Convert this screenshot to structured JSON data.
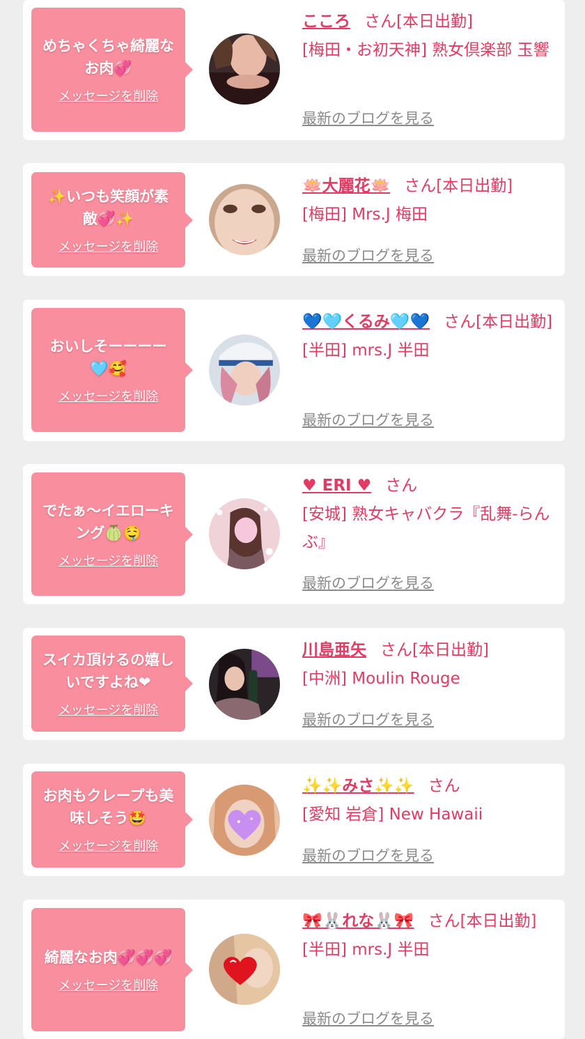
{
  "common": {
    "delete_label": "メッセージを削除",
    "blog_label": "最新のブログを見る"
  },
  "colors": {
    "bubble": "#f98f9e",
    "accent": "#e03c63",
    "link_gray": "#8a8a8a",
    "background": "#eeeeee"
  },
  "entries": [
    {
      "message": "めちゃくちゃ綺麗なお肉💞",
      "name": "こころ",
      "suffix": "さん[本日出勤]",
      "shop": "[梅田・お初天神] 熟女倶楽部 玉響"
    },
    {
      "message": "✨いつも笑顔が素敵💞✨",
      "name": "🪷大麗花🪷",
      "suffix": "さん[本日出勤]",
      "shop": "[梅田] Mrs.J 梅田"
    },
    {
      "message": "おいしそーーーー🩵🥰",
      "name": "💙🩵くるみ🩵💙",
      "suffix": "さん[本日出勤]",
      "shop": "[半田] mrs.J 半田"
    },
    {
      "message": "でたぁ〜イエローキング🍈🤤",
      "name": "♥ ERI ♥",
      "suffix": "さん",
      "shop": "[安城] 熟女キャバクラ『乱舞-らんぶ』"
    },
    {
      "message": "スイカ頂けるの嬉しいですよね❤",
      "name": "川島亜矢",
      "suffix": "さん[本日出勤]",
      "shop": "[中洲] Moulin Rouge"
    },
    {
      "message": "お肉もクレープも美味しそう🤩",
      "name": "✨✨みさ✨✨",
      "suffix": "さん",
      "shop": "[愛知 岩倉] New Hawaii"
    },
    {
      "message": "綺麗なお肉💞💞💞",
      "name": "🎀🐰れな🐰🎀",
      "suffix": "さん[本日出勤]",
      "shop": "[半田] mrs.J 半田"
    }
  ]
}
